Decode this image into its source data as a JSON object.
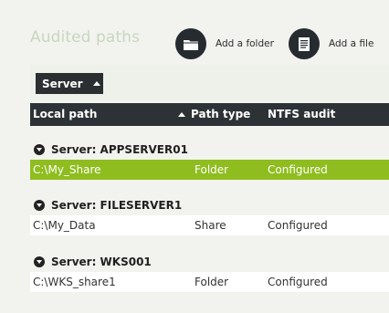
{
  "title": "Audited paths",
  "toolbar": {
    "add_folder_label": "Add a folder",
    "add_file_label": "Add a file"
  },
  "group_by": {
    "label": "Server"
  },
  "columns": {
    "local_path": "Local path",
    "path_type": "Path type",
    "ntfs_audit": "NTFS audit"
  },
  "groups": [
    {
      "label": "Server: APPSERVER01",
      "rows": [
        {
          "local_path": "C:\\My_Share",
          "path_type": "Folder",
          "ntfs_audit": "Configured"
        }
      ]
    },
    {
      "label": "Server: FILESERVER1",
      "rows": [
        {
          "local_path": "C:\\My_Data",
          "path_type": "Share",
          "ntfs_audit": "Configured"
        }
      ]
    },
    {
      "label": "Server: WKS001",
      "rows": [
        {
          "local_path": "C:\\WKS_share1",
          "path_type": "Folder",
          "ntfs_audit": "Configured"
        }
      ]
    }
  ],
  "colors": {
    "selected_row": "#8fbd1f",
    "header_bg": "#2d3236",
    "title_text": "#c9d6be"
  },
  "icons": {
    "add_folder": "folder-icon",
    "add_file": "document-icon",
    "sort": "sort-ascending-icon",
    "group_toggle": "collapse-icon"
  }
}
